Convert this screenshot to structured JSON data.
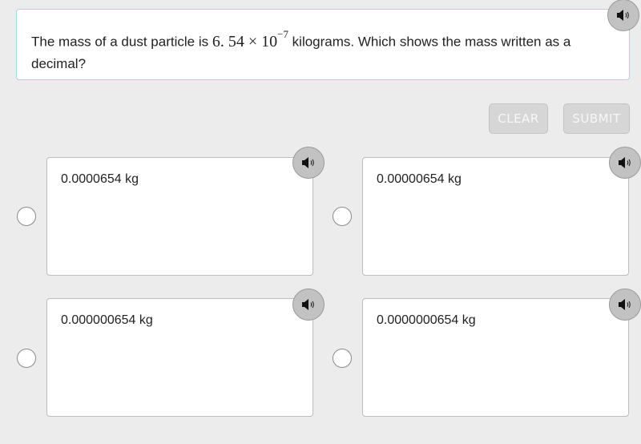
{
  "question": {
    "text_before": "The mass of a dust particle is ",
    "math_base": "6. 54 × 10",
    "math_exponent": "−7",
    "text_after": " kilograms. Which shows the mass written as a decimal?",
    "audio_icon": "speaker-icon"
  },
  "actions": {
    "clear_label": "CLEAR",
    "submit_label": "SUBMIT"
  },
  "choices": [
    {
      "label": "0.0000654 kg",
      "selected": false,
      "audio_icon": "speaker-icon"
    },
    {
      "label": "0.00000654 kg",
      "selected": false,
      "audio_icon": "speaker-icon"
    },
    {
      "label": "0.000000654 kg",
      "selected": false,
      "audio_icon": "speaker-icon"
    },
    {
      "label": "0.0000000654 kg",
      "selected": false,
      "audio_icon": "speaker-icon"
    }
  ],
  "colors": {
    "question_border": "#a8d8df",
    "button_disabled": "#d6d6d6",
    "audio_button": "#c2c2c2",
    "background": "#ececec"
  }
}
